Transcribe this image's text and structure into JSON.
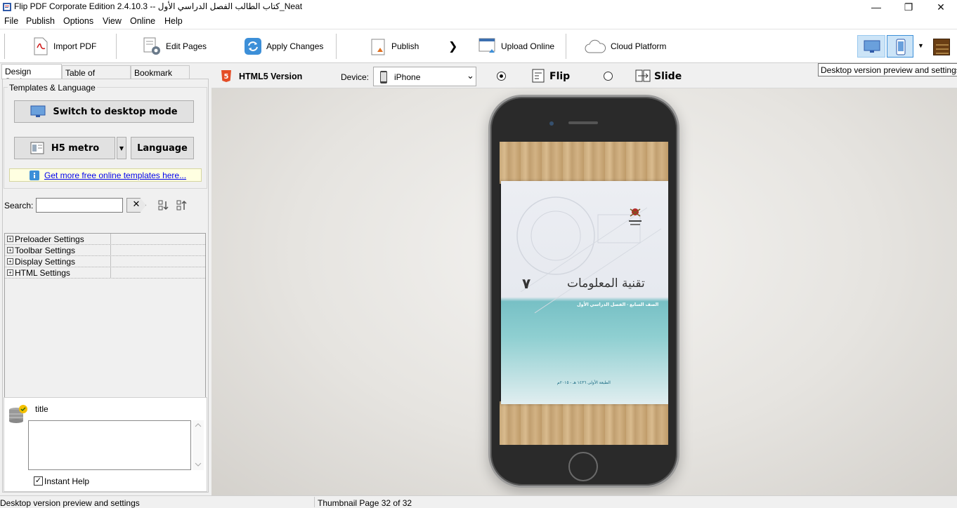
{
  "window": {
    "title": "Flip PDF Corporate Edition 2.4.10.3 -- كتاب الطالب الفصل الدراسي الأول_Neat",
    "minimize": "—",
    "maximize": "❐",
    "close": "✕"
  },
  "menu": [
    "File",
    "Publish",
    "Options",
    "View",
    "Online",
    "Help"
  ],
  "toolbar": {
    "import_pdf": "Import PDF",
    "edit_pages": "Edit Pages",
    "apply_changes": "Apply Changes",
    "publish": "Publish",
    "arrow": "❯",
    "upload_online": "Upload Online",
    "cloud_platform": "Cloud Platform",
    "dropdown": "▼"
  },
  "tabs": [
    "Design Settings",
    "Table of Contents",
    "Bookmark Tabs"
  ],
  "design": {
    "group_label": "Templates & Language",
    "switch_desktop": "Switch to desktop mode",
    "template_name": "H5 metro",
    "template_dropdown": "▼",
    "language": "Language",
    "more_templates_link": "Get more free online templates here...",
    "search_label": "Search:",
    "search_value": "",
    "clear_icon": "✕",
    "tree": [
      "Preloader Settings",
      "Toolbar Settings",
      "Display Settings",
      "HTML Settings"
    ],
    "tree_expander": "+",
    "help_title": "title",
    "help_text": "",
    "instant_help": "Instant Help",
    "instant_help_checked": "✓"
  },
  "preview": {
    "version_label": "HTML5 Version",
    "html5_badge": "5",
    "device_label": "Device:",
    "device_value": "iPhone",
    "device_chevron": "⌄",
    "mode_flip": "Flip",
    "mode_slide": "Slide",
    "selected_mode": "Flip"
  },
  "book": {
    "title_ar": "تقنية المعلومات",
    "grade_number": "٧",
    "subtitle_ar": "الصف السابع - الفصل الدراسي الأول",
    "edition_ar": "الطبعة الأولى ١٤٣٦ هـ - ٢٠١٥م"
  },
  "tooltip": "Desktop version preview and settings",
  "status": {
    "left": "Desktop version preview and settings",
    "right": "Thumbnail Page 32 of 32"
  },
  "colors": {
    "html5_orange": "#e44d26",
    "link_blue": "#0000ee",
    "accent_blue": "#3c8fd8",
    "teal": "#7cc4c8"
  }
}
